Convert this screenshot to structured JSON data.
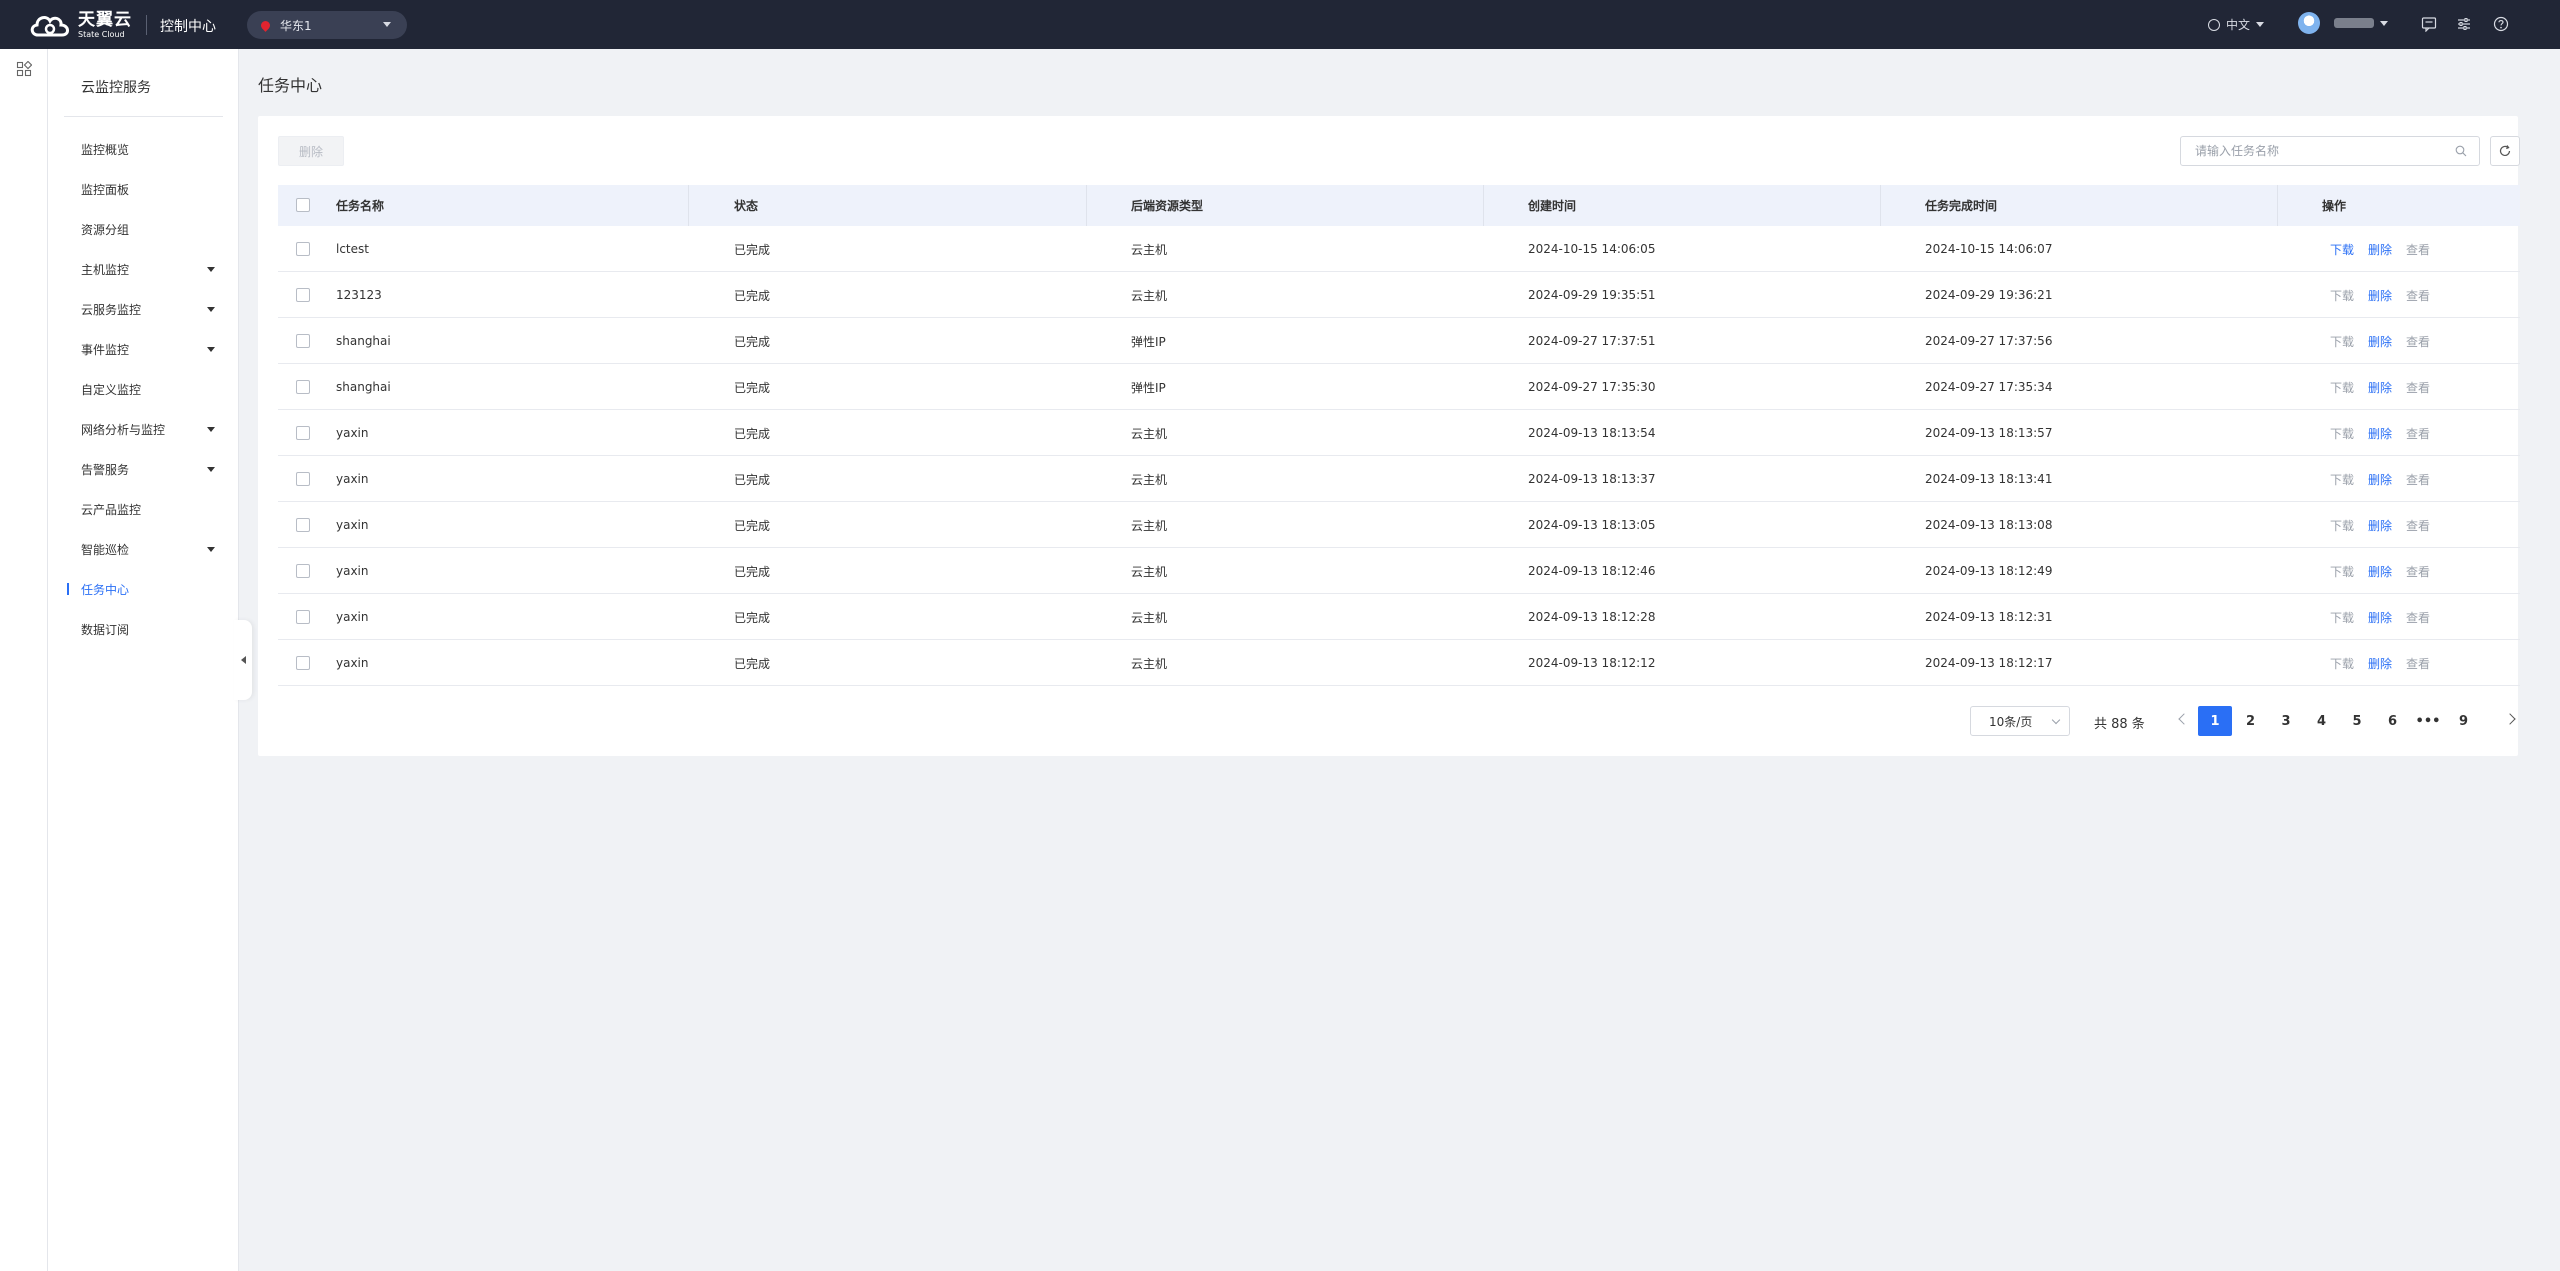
{
  "header": {
    "brand_cn": "天翼云",
    "brand_en": "State Cloud",
    "console_title": "控制中心",
    "region": "华东1",
    "language": "中文"
  },
  "sidebar": {
    "title": "云监控服务",
    "items": [
      {
        "label": "监控概览",
        "has_submenu": false,
        "active": false
      },
      {
        "label": "监控面板",
        "has_submenu": false,
        "active": false
      },
      {
        "label": "资源分组",
        "has_submenu": false,
        "active": false
      },
      {
        "label": "主机监控",
        "has_submenu": true,
        "active": false
      },
      {
        "label": "云服务监控",
        "has_submenu": true,
        "active": false
      },
      {
        "label": "事件监控",
        "has_submenu": true,
        "active": false
      },
      {
        "label": "自定义监控",
        "has_submenu": false,
        "active": false
      },
      {
        "label": "网络分析与监控",
        "has_submenu": true,
        "active": false
      },
      {
        "label": "告警服务",
        "has_submenu": true,
        "active": false
      },
      {
        "label": "云产品监控",
        "has_submenu": false,
        "active": false
      },
      {
        "label": "智能巡检",
        "has_submenu": true,
        "active": false
      },
      {
        "label": "任务中心",
        "has_submenu": false,
        "active": true
      },
      {
        "label": "数据订阅",
        "has_submenu": false,
        "active": false
      }
    ]
  },
  "main": {
    "page_title": "任务中心",
    "delete_label": "删除",
    "search_placeholder": "请输入任务名称",
    "table": {
      "columns": [
        "任务名称",
        "状态",
        "后端资源类型",
        "创建时间",
        "任务完成时间",
        "操作"
      ],
      "action_labels": [
        "下载",
        "删除",
        "查看"
      ],
      "rows": [
        {
          "name": "lctest",
          "status": "已完成",
          "type": "云主机",
          "created": "2024-10-15 14:06:05",
          "finished": "2024-10-15 14:06:07",
          "download_enabled": true
        },
        {
          "name": "123123",
          "status": "已完成",
          "type": "云主机",
          "created": "2024-09-29 19:35:51",
          "finished": "2024-09-29 19:36:21",
          "download_enabled": false
        },
        {
          "name": "shanghai",
          "status": "已完成",
          "type": "弹性IP",
          "created": "2024-09-27 17:37:51",
          "finished": "2024-09-27 17:37:56",
          "download_enabled": false
        },
        {
          "name": "shanghai",
          "status": "已完成",
          "type": "弹性IP",
          "created": "2024-09-27 17:35:30",
          "finished": "2024-09-27 17:35:34",
          "download_enabled": false
        },
        {
          "name": "yaxin",
          "status": "已完成",
          "type": "云主机",
          "created": "2024-09-13 18:13:54",
          "finished": "2024-09-13 18:13:57",
          "download_enabled": false
        },
        {
          "name": "yaxin",
          "status": "已完成",
          "type": "云主机",
          "created": "2024-09-13 18:13:37",
          "finished": "2024-09-13 18:13:41",
          "download_enabled": false
        },
        {
          "name": "yaxin",
          "status": "已完成",
          "type": "云主机",
          "created": "2024-09-13 18:13:05",
          "finished": "2024-09-13 18:13:08",
          "download_enabled": false
        },
        {
          "name": "yaxin",
          "status": "已完成",
          "type": "云主机",
          "created": "2024-09-13 18:12:46",
          "finished": "2024-09-13 18:12:49",
          "download_enabled": false
        },
        {
          "name": "yaxin",
          "status": "已完成",
          "type": "云主机",
          "created": "2024-09-13 18:12:28",
          "finished": "2024-09-13 18:12:31",
          "download_enabled": false
        },
        {
          "name": "yaxin",
          "status": "已完成",
          "type": "云主机",
          "created": "2024-09-13 18:12:12",
          "finished": "2024-09-13 18:12:17",
          "download_enabled": false
        }
      ]
    },
    "pagination": {
      "page_size": "10条/页",
      "total": "共 88 条",
      "pages": [
        "1",
        "2",
        "3",
        "4",
        "5",
        "6",
        "•••",
        "9"
      ],
      "current": "1"
    }
  },
  "colors": {
    "topbar": "#212636",
    "accent": "#2a6ff5",
    "brand_red": "#e2242f"
  },
  "icons": [
    "cloud-logo-icon",
    "location-pin-icon",
    "globe-icon",
    "message-icon",
    "settings-icon",
    "help-icon",
    "apps-grid-icon",
    "search-icon",
    "refresh-icon"
  ]
}
